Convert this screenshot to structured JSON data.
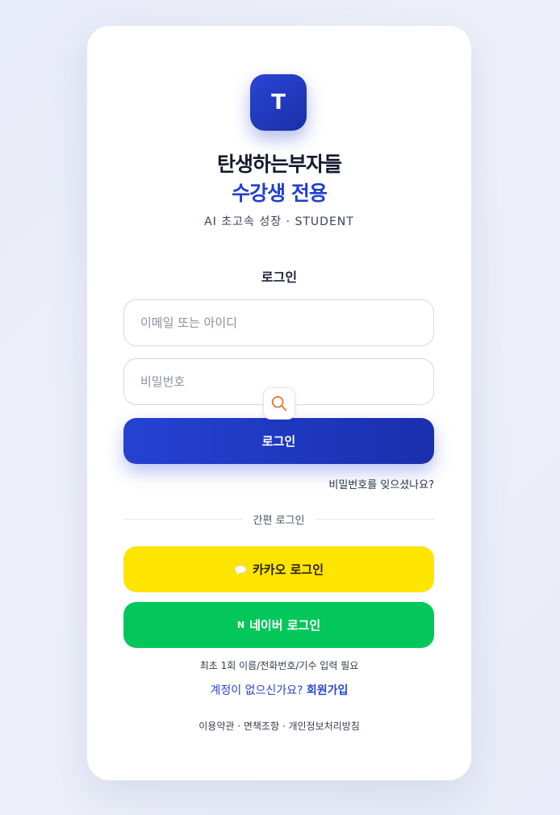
{
  "brand": {
    "logo_letter": "T",
    "title": "탄생하는부자들",
    "subtitle": "수강생 전용",
    "tagline": "AI 초고속 성장 · STUDENT"
  },
  "login": {
    "heading": "로그인",
    "email_placeholder": "이메일 또는 아이디",
    "password_placeholder": "비밀번호",
    "submit_label": "로그인",
    "forgot_label": "비밀번호를 잊으셨나요?"
  },
  "social": {
    "divider_label": "간편 로그인",
    "kakao_label": "카카오 로그인",
    "naver_mark": "N",
    "naver_label": "네이버 로그인"
  },
  "notice": "최초 1회 이름/전화번호/기수 입력 필요",
  "signup": {
    "prompt": "계정이 없으신가요?",
    "link_label": "회원가입"
  },
  "footer": "이용약관 · 면책조항 · 개인정보처리방침",
  "icons": {
    "search": "search-icon",
    "kakao": "speech-bubble-icon",
    "naver": "naver-n-icon"
  },
  "colors": {
    "accent": "#1f3fd1",
    "kakao": "#fee500",
    "naver": "#03c75a",
    "search_icon": "#e07a2e"
  }
}
